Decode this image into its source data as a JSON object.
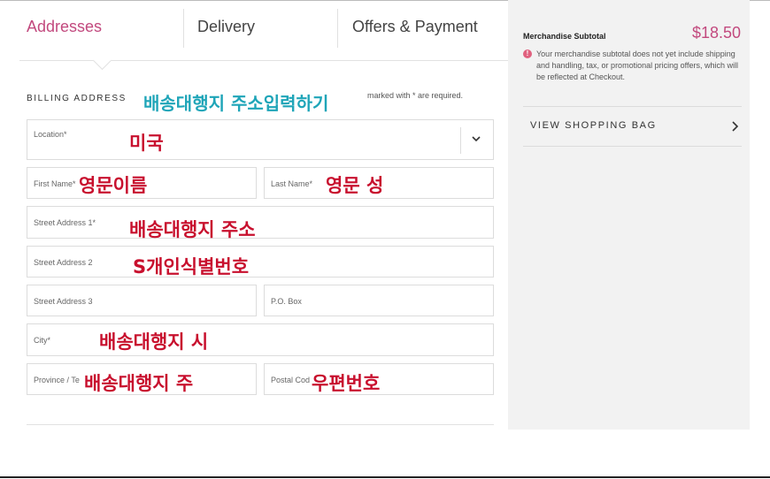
{
  "tabs": [
    {
      "label": "Addresses",
      "active": true
    },
    {
      "label": "Delivery",
      "active": false
    },
    {
      "label": "Offers & Payment",
      "active": false
    }
  ],
  "billing": {
    "section_title": "BILLING ADDRESS",
    "required_note": "marked with * are required.",
    "fields": {
      "location": "Location*",
      "first_name": "First Name*",
      "last_name": "Last Name*",
      "street1": "Street Address 1*",
      "street2": "Street Address 2",
      "street3": "Street Address 3",
      "po_box": "P.O. Box",
      "city": "City*",
      "province": "Province / Te",
      "postal": "Postal Cod"
    }
  },
  "annotations": {
    "title": "배송대행지 주소입력하기",
    "location": "미국",
    "first_name": "영문이름",
    "last_name": "영문 성",
    "street1": "배송대행지 주소",
    "street2": "S개인식별번호",
    "city": "배송대행지 시",
    "province": "배송대행지 주",
    "postal": "우편번호"
  },
  "summary": {
    "subtotal_label": "Merchandise Subtotal",
    "subtotal_amount": "$18.50",
    "info_icon": "!",
    "info_text": "Your merchandise subtotal does not yet include shipping and handling, tax, or promotional pricing offers, which will be reflected at Checkout.",
    "view_bag": "VIEW SHOPPING BAG"
  },
  "colors": {
    "accent": "#c2497e",
    "annotation_red": "#c8102e",
    "annotation_teal": "#1fa5b8",
    "panel_bg": "#f2f2f2"
  },
  "icons": {
    "location_dropdown": "chevron-down-icon",
    "view_bag": "chevron-right-icon",
    "info": "info-icon"
  }
}
